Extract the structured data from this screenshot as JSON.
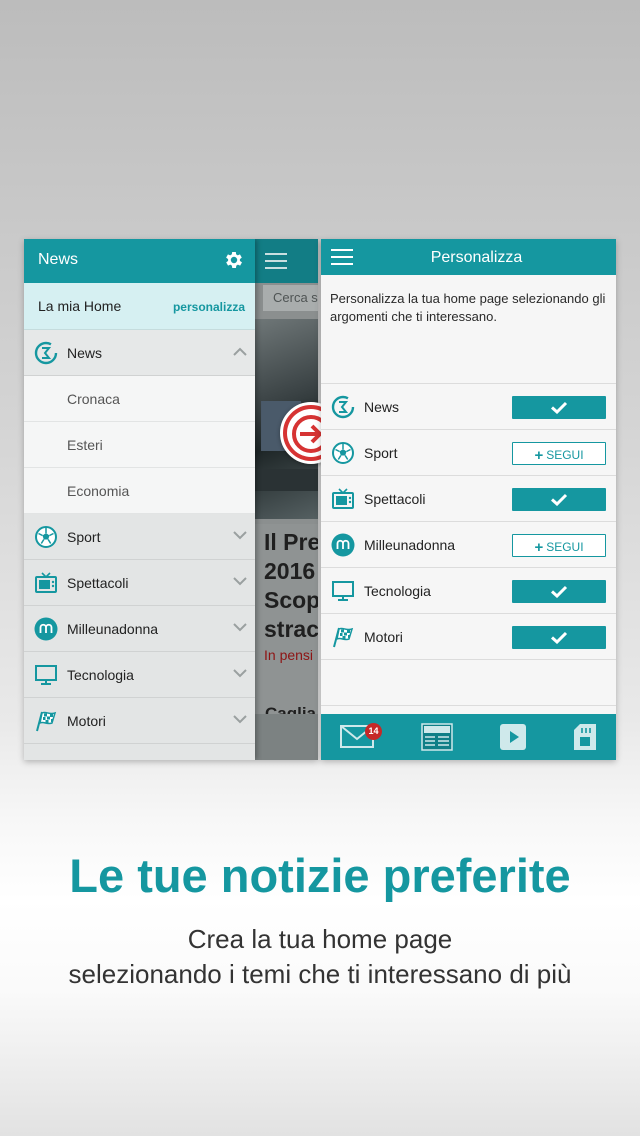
{
  "colors": {
    "accent": "#1597a0",
    "badge": "#c62828",
    "arrow": "#d63333"
  },
  "left_screen": {
    "header_title": "News",
    "home_row": {
      "label": "La mia Home",
      "link": "personalizza"
    },
    "menu": [
      {
        "label": "News",
        "icon": "news-icon",
        "expanded": true
      },
      {
        "label": "Sport",
        "icon": "soccer-ball-icon"
      },
      {
        "label": "Spettacoli",
        "icon": "tv-icon"
      },
      {
        "label": "Milleunadonna",
        "icon": "milleunadonna-icon"
      },
      {
        "label": "Tecnologia",
        "icon": "monitor-icon"
      },
      {
        "label": "Motori",
        "icon": "checkered-flag-icon"
      }
    ],
    "submenu": [
      "Cronaca",
      "Esteri",
      "Economia"
    ],
    "behind": {
      "search_placeholder": "Cerca s",
      "headline_fragment": "Il Pre\n2016\nScop\nstrac",
      "red_fragment": "In pensi",
      "second_fragment": "Caglia"
    }
  },
  "right_screen": {
    "header_title": "Personalizza",
    "intro": "Personalizza la tua home page selezionando gli argomenti che ti interessano.",
    "topics": [
      {
        "label": "News",
        "icon": "news-icon",
        "followed": true
      },
      {
        "label": "Sport",
        "icon": "soccer-ball-icon",
        "followed": false
      },
      {
        "label": "Spettacoli",
        "icon": "tv-icon",
        "followed": true
      },
      {
        "label": "Milleunadonna",
        "icon": "milleunadonna-icon",
        "followed": false
      },
      {
        "label": "Tecnologia",
        "icon": "monitor-icon",
        "followed": true
      },
      {
        "label": "Motori",
        "icon": "checkered-flag-icon",
        "followed": true
      }
    ],
    "follow_label": "SEGUI",
    "tabs": [
      {
        "icon": "mail-icon",
        "badge": "14"
      },
      {
        "icon": "newspaper-icon"
      },
      {
        "icon": "play-icon"
      },
      {
        "icon": "sd-card-icon"
      }
    ]
  },
  "caption": {
    "headline": "Le tue notizie preferite",
    "line1": "Crea la tua home page",
    "line2": "selezionando i temi che ti interessano di più"
  }
}
